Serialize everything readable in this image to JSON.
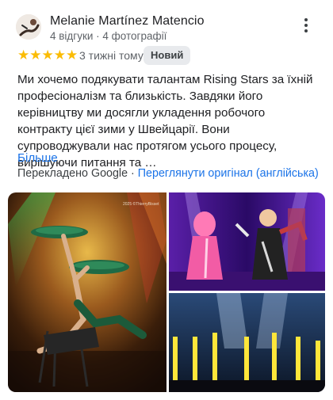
{
  "review": {
    "author": "Melanie Martínez Matencio",
    "author_meta": "4 відгуки · 4 фотографії",
    "stars": "★★★★★",
    "time_ago": "3 тижні тому",
    "badge": "Новий",
    "text": "Ми хочемо подякувати талантам Rising Stars за їхній професіоналізм та близькість. Завдяки його керівництву ми досягли укладення робочого контракту цієї зими у Швейцарії. Вони супроводжували нас протягом усього процесу, вирішуючи питання та …",
    "more_label": "Більше",
    "translated_by": "Перекладено Google · ",
    "see_original": "Переглянути оригінал (англійська)"
  },
  "photos": {
    "watermark": "2025 ©ThierryBisset"
  },
  "icons": {
    "menu": "more-vert-icon",
    "star": "star-icon"
  },
  "colors": {
    "star": "#fbbc04",
    "link": "#1a73e8",
    "badge_bg": "#e8eaed"
  }
}
